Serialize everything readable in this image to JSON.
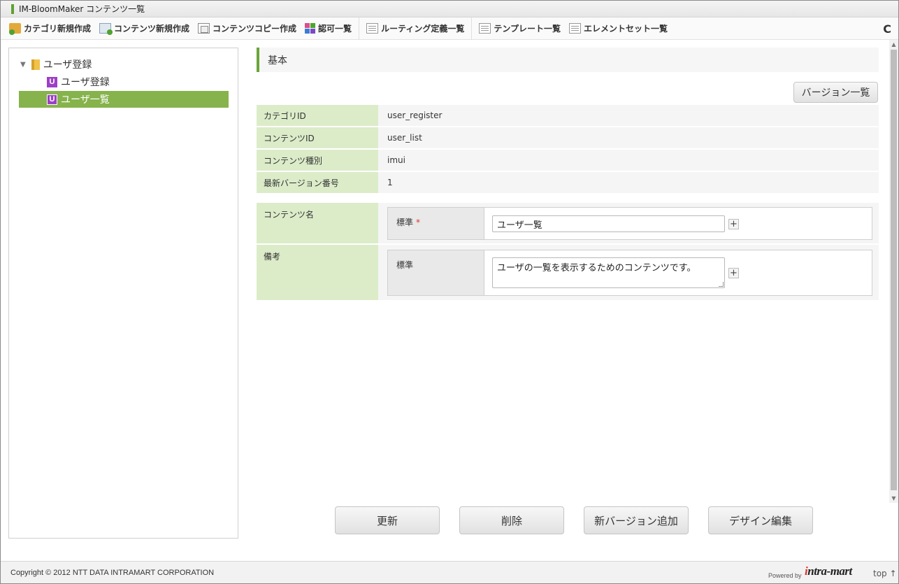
{
  "window": {
    "title": "IM-BloomMaker コンテンツ一覧"
  },
  "toolbar": {
    "items": [
      {
        "label": "カテゴリ新規作成",
        "icon": "category-new-icon"
      },
      {
        "label": "コンテンツ新規作成",
        "icon": "content-new-icon"
      },
      {
        "label": "コンテンツコピー作成",
        "icon": "content-copy-icon"
      },
      {
        "label": "認可一覧",
        "icon": "permission-icon"
      },
      {
        "label": "ルーティング定義一覧",
        "icon": "routing-list-icon"
      },
      {
        "label": "テンプレート一覧",
        "icon": "template-list-icon"
      },
      {
        "label": "エレメントセット一覧",
        "icon": "elementset-list-icon"
      }
    ],
    "reload_icon": "reload-icon",
    "reload_glyph": "C"
  },
  "tree": {
    "root": {
      "label": "ユーザ登録",
      "expanded": true,
      "icon": "folder-icon"
    },
    "children": [
      {
        "label": "ユーザ登録",
        "badge": "U",
        "selected": false
      },
      {
        "label": "ユーザ一覧",
        "badge": "U",
        "selected": true
      }
    ]
  },
  "section": {
    "title": "基本",
    "version_button": "バージョン一覧"
  },
  "info": [
    {
      "label": "カテゴリID",
      "value": "user_register"
    },
    {
      "label": "コンテンツID",
      "value": "user_list"
    },
    {
      "label": "コンテンツ種別",
      "value": "imui"
    },
    {
      "label": "最新バージョン番号",
      "value": "1"
    }
  ],
  "form": {
    "content_name": {
      "label": "コンテンツ名",
      "locale_label": "標準",
      "required_mark": "*",
      "value": "ユーザ一覧"
    },
    "remarks": {
      "label": "備考",
      "locale_label": "標準",
      "value": "ユーザの一覧を表示するためのコンテンツです。"
    },
    "plus_glyph": "+"
  },
  "actions": {
    "update": "更新",
    "delete": "削除",
    "add_version": "新バージョン追加",
    "edit_design": "デザイン編集"
  },
  "footer": {
    "copyright": "Copyright © 2012 NTT DATA INTRAMART CORPORATION",
    "powered_by": "Powered by",
    "brand_i": "i",
    "brand_rest": "ntra-mart",
    "top_link": "top ↑"
  },
  "colors": {
    "accent_green": "#86b34c",
    "label_bg": "#dcecc9",
    "required": "#e0342c",
    "badge_purple": "#9d3fc8"
  }
}
